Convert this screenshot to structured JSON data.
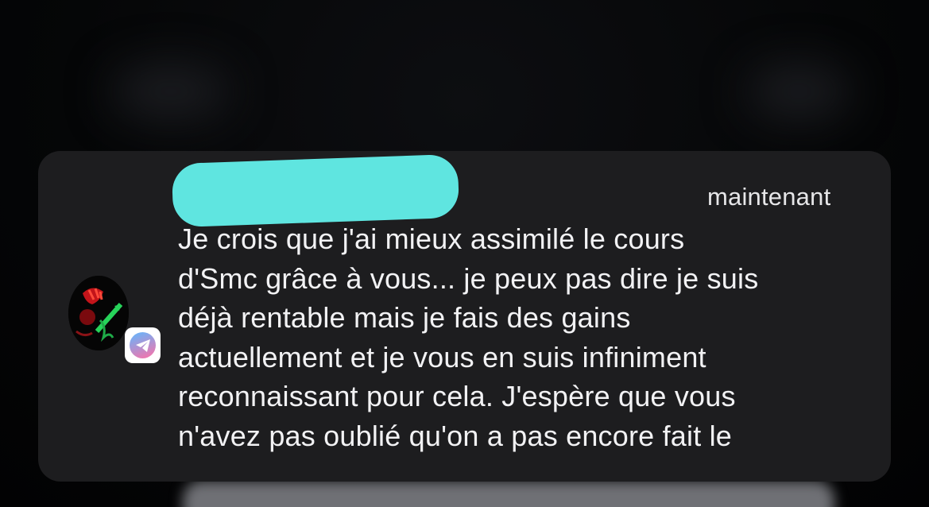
{
  "screen": {
    "background_color": "#000000"
  },
  "notification": {
    "background_color": "#1d1d1f",
    "app": {
      "name": "Telegram",
      "icon": "telegram-icon"
    },
    "avatar": {
      "icon": "contact-avatar"
    },
    "sender": {
      "redaction_color": "#5fe5e0"
    },
    "timestamp": "maintenant",
    "message": "Je crois que j'ai mieux assimilé le cours\nd'Smc grâce à vous... je peux pas dire je suis\ndéjà rentable mais je fais des gains\nactuellement et je vous en suis infiniment\nreconnaissant pour cela. J'espère que vous\nn'avez pas oublié qu'on a pas encore fait le"
  }
}
